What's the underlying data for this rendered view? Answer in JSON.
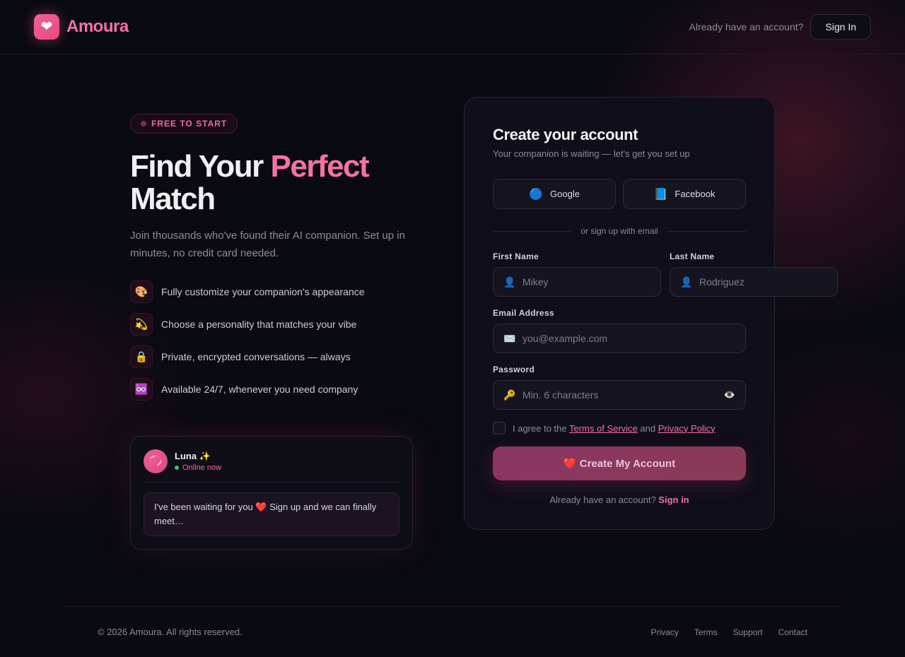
{
  "brand": {
    "name": "Amoura",
    "logo_icon": "heart-icon"
  },
  "header": {
    "hint": "Already have an account?",
    "signin_label": "Sign In"
  },
  "hero": {
    "badge": "FREE TO START",
    "title_part1": "Find Your ",
    "title_accent": "Perfect",
    "title_part2": "Match",
    "subtitle": "Join thousands who've found their AI companion. Set up in minutes, no credit card needed."
  },
  "features": [
    {
      "icon": "🎨",
      "icon_name": "palette-icon",
      "text": "Fully customize your companion's appearance"
    },
    {
      "icon": "💫",
      "icon_name": "dizzy-star-icon",
      "text": "Choose a personality that matches your vibe"
    },
    {
      "icon": "🔒",
      "icon_name": "lock-icon",
      "text": "Private, encrypted conversations — always"
    },
    {
      "icon": "♾️",
      "icon_name": "infinity-icon",
      "text": "Available 24/7, whenever you need company"
    }
  ],
  "chat": {
    "avatar": "💞",
    "name": "Luna ✨",
    "status": "Online now",
    "message": "I've been waiting for you ❤️ Sign up and we can finally meet…"
  },
  "form": {
    "title": "Create your account",
    "subtitle": "Your companion is waiting — let's get you set up",
    "google_label": "Google",
    "facebook_label": "Facebook",
    "divider": "or sign up with email",
    "first_name_label": "First Name",
    "first_name_placeholder": "Mikey",
    "last_name_label": "Last Name",
    "last_name_placeholder": "Rodriguez",
    "email_label": "Email Address",
    "email_placeholder": "you@example.com",
    "password_label": "Password",
    "password_placeholder": "Min. 6 characters",
    "agree_prefix": "I agree to the ",
    "terms_link": "Terms of Service",
    "agree_and": " and ",
    "privacy_link": "Privacy Policy",
    "create_button": "❤️ Create My Account",
    "foot_text": "Already have an account? ",
    "foot_link": "Sign in"
  },
  "footer": {
    "copyright": "© 2026 Amoura. All rights reserved.",
    "links": [
      "Privacy",
      "Terms",
      "Support",
      "Contact"
    ]
  },
  "colors": {
    "accent": "#f472a2",
    "background": "#0a0a12",
    "online": "#3ec46d"
  }
}
